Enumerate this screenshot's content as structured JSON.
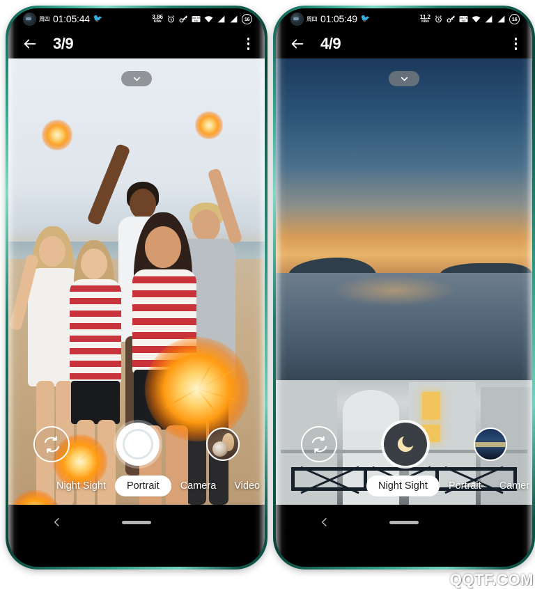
{
  "watermark": "QQTF.COM",
  "phones": [
    {
      "id": "left",
      "statusbar": {
        "day": "周四",
        "time": "01:05:44",
        "bird_icon": "bird-icon",
        "net_speed_value": "3.86",
        "net_speed_unit": "KB/s",
        "alarm_icon": "alarm-icon",
        "key_icon": "key-icon",
        "volte_icon": "volte-icon",
        "wifi_icon": "wifi-icon",
        "signal1_icon": "signal-bars-icon",
        "signal2_icon": "signal-bars-icon",
        "battery_level": "16"
      },
      "appbar": {
        "back_icon": "arrow-left-icon",
        "title": "3/9",
        "menu_icon": "overflow-menu-icon"
      },
      "viewfinder": {
        "collapse_icon": "chevron-down-icon",
        "scene": "beach-group-sparklers"
      },
      "controls": {
        "switch_camera_icon": "camera-flip-icon",
        "shutter_icon": "shutter-button",
        "shutter_mode": "portrait",
        "thumbnail_icon": "gallery-thumbnail"
      },
      "modes": [
        {
          "label": "Night Sight",
          "active": false
        },
        {
          "label": "Portrait",
          "active": true
        },
        {
          "label": "Camera",
          "active": false
        },
        {
          "label": "Video",
          "active": false
        }
      ],
      "navbar": {
        "back_icon": "nav-back-icon",
        "home_icon": "nav-home-indicator"
      }
    },
    {
      "id": "right",
      "statusbar": {
        "day": "周四",
        "time": "01:05:49",
        "bird_icon": "bird-icon",
        "net_speed_value": "11.2",
        "net_speed_unit": "KB/s",
        "alarm_icon": "alarm-icon",
        "key_icon": "key-icon",
        "volte_icon": "volte-icon",
        "wifi_icon": "wifi-icon",
        "signal1_icon": "signal-bars-icon",
        "signal2_icon": "signal-bars-icon",
        "battery_level": "16"
      },
      "appbar": {
        "back_icon": "arrow-left-icon",
        "title": "4/9",
        "menu_icon": "overflow-menu-icon"
      },
      "viewfinder": {
        "collapse_icon": "chevron-down-icon",
        "scene": "santorini-dusk-seascape"
      },
      "controls": {
        "switch_camera_icon": "camera-flip-icon",
        "shutter_icon": "moon-icon",
        "shutter_mode": "night-sight",
        "thumbnail_icon": "gallery-thumbnail"
      },
      "modes": [
        {
          "label": "Night Sight",
          "active": true
        },
        {
          "label": "Portrait",
          "active": false
        },
        {
          "label": "Camer",
          "active": false
        }
      ],
      "navbar": {
        "back_icon": "nav-back-icon",
        "home_icon": "nav-home-indicator"
      }
    }
  ],
  "colors": {
    "frame": "#2f9b85",
    "screen_bg": "#000000",
    "accent_white": "#ffffff",
    "night_shutter": "#3a3f45",
    "moon": "#f6e3b0"
  }
}
